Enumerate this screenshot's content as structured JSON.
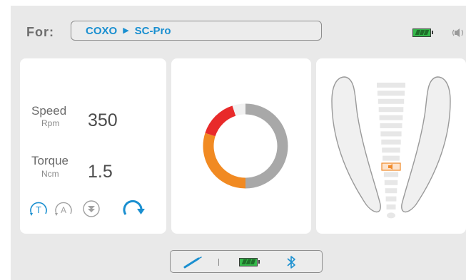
{
  "header": {
    "for_label": "For:",
    "brand": "COXO",
    "model": "SC-Pro"
  },
  "status_icons": {
    "battery": "battery-full-icon",
    "sound": "speaker-volume-icon"
  },
  "settings": {
    "speed_label": "Speed",
    "speed_unit": "Rpm",
    "speed_value": "350",
    "torque_label": "Torque",
    "torque_unit": "Ncm",
    "torque_value": "1.5"
  },
  "modes": [
    {
      "name": "torque-mode",
      "glyph": "T",
      "active": true
    },
    {
      "name": "auto-mode",
      "glyph": "A",
      "active": false
    },
    {
      "name": "down-mode",
      "glyph": "▼",
      "active": false
    }
  ],
  "rotation": "clockwise",
  "gauge": {
    "segments": [
      {
        "label": "gray",
        "fraction": 0.5,
        "color": "#a8a8a8"
      },
      {
        "label": "orange",
        "fraction": 0.3,
        "color": "#f18a22"
      },
      {
        "label": "red",
        "fraction": 0.15,
        "color": "#e82a2a"
      },
      {
        "label": "gap",
        "fraction": 0.05,
        "color": "#f1f1f1"
      }
    ]
  },
  "apex": {
    "bars_total": 16,
    "marker_index": 10,
    "marker_color": "#f08a2a"
  },
  "bottom_bar": {
    "handpiece_icon": "handpiece-icon",
    "battery_icon": "battery-full-icon",
    "bluetooth_icon": "bluetooth-icon"
  },
  "colors": {
    "accent": "#1a8fd0",
    "battery_green": "#35b94b",
    "background": "#e9e9e9"
  }
}
